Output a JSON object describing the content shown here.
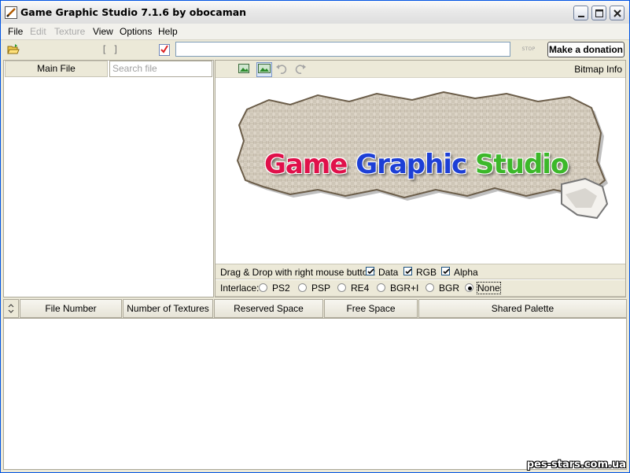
{
  "window": {
    "title": "Game Graphic Studio 7.1.6 by obocaman"
  },
  "menu": [
    {
      "label": "File",
      "enabled": true
    },
    {
      "label": "Edit",
      "enabled": false
    },
    {
      "label": "Texture",
      "enabled": false
    },
    {
      "label": "View",
      "enabled": true
    },
    {
      "label": "Options",
      "enabled": true
    },
    {
      "label": "Help",
      "enabled": true
    }
  ],
  "toolbar": {
    "path_value": "",
    "stop_label": "STOP",
    "donate_label": "Make a donation"
  },
  "left_panel": {
    "main_file_label": "Main File",
    "search_placeholder": "Search file"
  },
  "right_panel": {
    "bitmap_info_label": "Bitmap Info",
    "logo_words": [
      "Game",
      "Graphic",
      "Studio"
    ]
  },
  "drag_drop": {
    "label": "Drag & Drop with right mouse button:",
    "options": [
      {
        "label": "Data",
        "checked": true
      },
      {
        "label": "RGB",
        "checked": true
      },
      {
        "label": "Alpha",
        "checked": true
      }
    ]
  },
  "interlace": {
    "label": "Interlace:",
    "options": [
      "PS2",
      "PSP",
      "RE4",
      "BGR+I",
      "BGR",
      "None"
    ],
    "selected": "None"
  },
  "table": {
    "columns": [
      "File Number",
      "Number of Textures",
      "Reserved Space",
      "Free Space",
      "Shared Palette"
    ],
    "rows": []
  },
  "watermark": "pes-stars.com.ua"
}
